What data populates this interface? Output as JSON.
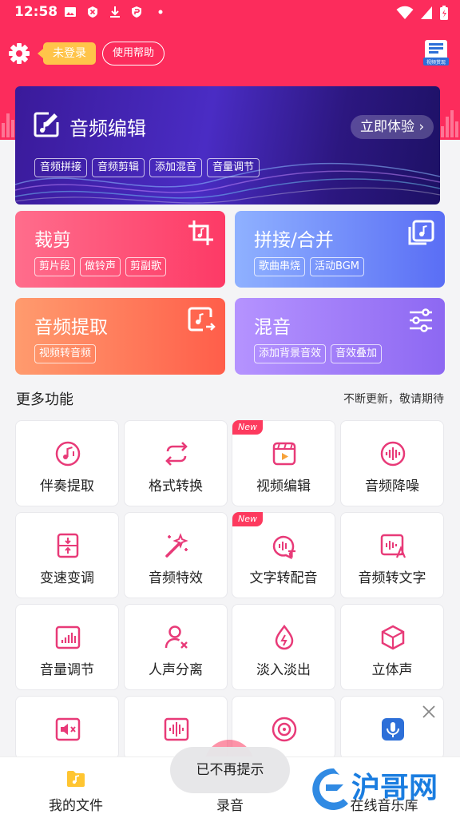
{
  "status_bar": {
    "time": "12:58"
  },
  "top_bar": {
    "login_badge": "未登录",
    "help_button": "使用帮助",
    "reward_label": "视频赏现"
  },
  "hero": {
    "title": "音频编辑",
    "try_button": "立即体验",
    "tags": [
      "音频拼接",
      "音频剪辑",
      "添加混音",
      "音量调节"
    ]
  },
  "tools": [
    {
      "title": "裁剪",
      "tags": [
        "剪片段",
        "做铃声",
        "剪副歌"
      ],
      "icon": "crop-icon"
    },
    {
      "title": "拼接/合并",
      "tags": [
        "歌曲串烧",
        "活动BGM"
      ],
      "icon": "merge-icon"
    },
    {
      "title": "音频提取",
      "tags": [
        "视频转音频"
      ],
      "icon": "extract-icon"
    },
    {
      "title": "混音",
      "tags": [
        "添加背景音效",
        "音效叠加"
      ],
      "icon": "mixer-icon"
    }
  ],
  "more": {
    "title": "更多功能",
    "note": "不断更新，敬请期待"
  },
  "features": [
    {
      "label": "伴奏提取",
      "icon": "accompaniment-icon",
      "new": false
    },
    {
      "label": "格式转换",
      "icon": "convert-icon",
      "new": false
    },
    {
      "label": "视频编辑",
      "icon": "video-edit-icon",
      "new": true
    },
    {
      "label": "音频降噪",
      "icon": "denoise-icon",
      "new": false
    },
    {
      "label": "变速变调",
      "icon": "speed-pitch-icon",
      "new": false
    },
    {
      "label": "音频特效",
      "icon": "magic-wand-icon",
      "new": false
    },
    {
      "label": "文字转配音",
      "icon": "tts-icon",
      "new": true
    },
    {
      "label": "音频转文字",
      "icon": "stt-icon",
      "new": false
    },
    {
      "label": "音量调节",
      "icon": "volume-bars-icon",
      "new": false
    },
    {
      "label": "人声分离",
      "icon": "vocal-split-icon",
      "new": false
    },
    {
      "label": "淡入淡出",
      "icon": "fade-icon",
      "new": false
    },
    {
      "label": "立体声",
      "icon": "stereo-cube-icon",
      "new": false
    }
  ],
  "new_badge": "New",
  "bottom_nav": {
    "files": "我的文件",
    "record": "录音",
    "library": "在线音乐库"
  },
  "toast": "已不再提示",
  "watermark": "沪哥网",
  "colors": {
    "brand": "#fc2c5c",
    "accent_pink": "#e83a78"
  }
}
